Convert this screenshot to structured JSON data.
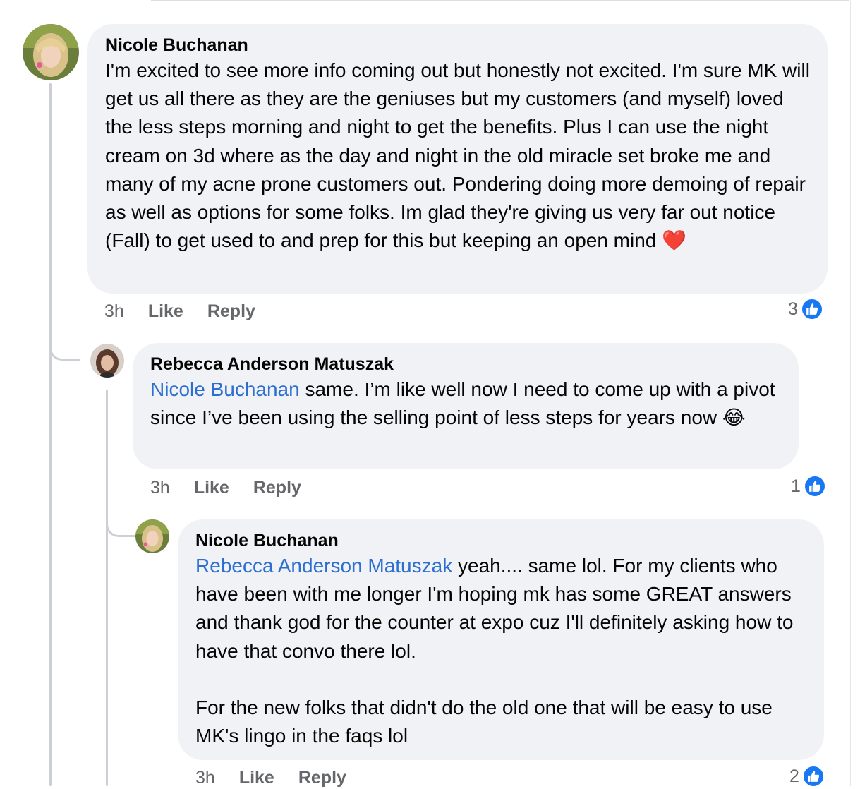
{
  "comments": [
    {
      "author": "Nicole Buchanan",
      "text": "I'm excited to see more info coming out but honestly not excited. I'm sure MK will get us all there as they are the geniuses but my customers (and myself) loved the less steps morning and night to get the benefits. Plus I can use the night cream on 3d where as the day and night in the old miracle set broke me and many of my acne prone customers out. Pondering doing more demoing of repair as well as options for some folks. Im glad they're giving us very far out notice (Fall) to get used to and prep for this but keeping an open mind",
      "emoji": "❤️",
      "time": "3h",
      "like_label": "Like",
      "reply_label": "Reply",
      "reaction_count": "3"
    },
    {
      "author": "Rebecca Anderson Matuszak",
      "mention": "Nicole Buchanan",
      "text": " same. I’m like well now I need to come up with a pivot since I’ve been using the selling point of less steps for years now",
      "emoji": "😂",
      "time": "3h",
      "like_label": "Like",
      "reply_label": "Reply",
      "reaction_count": "1"
    },
    {
      "author": "Nicole Buchanan",
      "mention": "Rebecca Anderson Matuszak",
      "text": " yeah.... same lol. For my clients who have been with me longer I'm hoping mk has some GREAT answers and thank god for the counter at expo cuz I'll definitely asking how to have that convo there lol.",
      "text2": "For the new folks that didn't do the old one that will be easy to use MK's lingo in the faqs lol",
      "time": "3h",
      "like_label": "Like",
      "reply_label": "Reply",
      "reaction_count": "2"
    }
  ],
  "colors": {
    "bubble": "#f0f2f5",
    "mention": "#2d6fd1",
    "meta": "#65676b",
    "like_badge": "#1877f2"
  },
  "icons": {
    "reaction": "thumbs-up-icon",
    "avatar": "profile-photo"
  }
}
